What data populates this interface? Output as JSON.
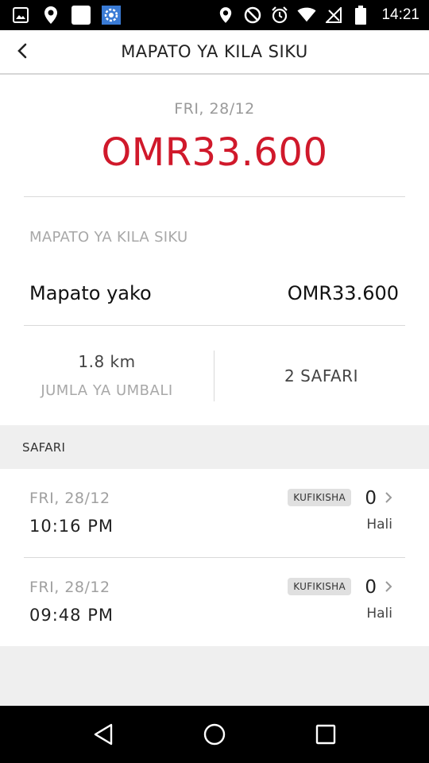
{
  "status_bar": {
    "time": "14:21",
    "left_icons": [
      "image-icon",
      "location-pin-icon",
      "square-icon",
      "settings-icon"
    ],
    "right_icons": [
      "location-pin-icon",
      "do-not-disturb-icon",
      "alarm-icon",
      "wifi-icon",
      "no-signal-icon",
      "battery-icon"
    ]
  },
  "header": {
    "title": "MAPATO YA KILA SIKU",
    "back_icon": "chevron-left-icon"
  },
  "summary": {
    "date": "FRI, 28/12",
    "total": "OMR33.600",
    "total_color": "#d0192b"
  },
  "earnings": {
    "section_title": "MAPATO YA KILA SIKU",
    "label": "Mapato yako",
    "value": "OMR33.600"
  },
  "stats": {
    "distance_value": "1.8 km",
    "distance_label": "JUMLA YA UMBALI",
    "trips": "2 SAFARI"
  },
  "trips": {
    "header": "SAFARI",
    "items": [
      {
        "date": "FRI, 28/12",
        "time": "10:16 PM",
        "badge": "KUFIKISHA",
        "fare": "0",
        "status": "Hali"
      },
      {
        "date": "FRI, 28/12",
        "time": "09:48 PM",
        "badge": "KUFIKISHA",
        "fare": "0",
        "status": "Hali"
      }
    ]
  },
  "nav_bar": {
    "icons": [
      "back-triangle-icon",
      "home-circle-icon",
      "recents-square-icon"
    ]
  }
}
